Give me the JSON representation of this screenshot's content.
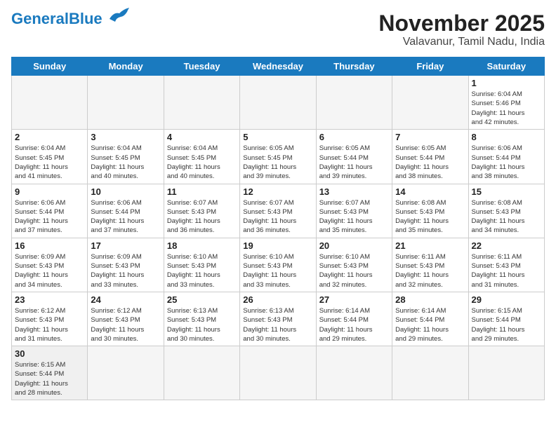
{
  "header": {
    "logo_general": "General",
    "logo_blue": "Blue",
    "month_title": "November 2025",
    "location": "Valavanur, Tamil Nadu, India"
  },
  "weekdays": [
    "Sunday",
    "Monday",
    "Tuesday",
    "Wednesday",
    "Thursday",
    "Friday",
    "Saturday"
  ],
  "rows": [
    [
      {
        "day": "",
        "info": ""
      },
      {
        "day": "",
        "info": ""
      },
      {
        "day": "",
        "info": ""
      },
      {
        "day": "",
        "info": ""
      },
      {
        "day": "",
        "info": ""
      },
      {
        "day": "",
        "info": ""
      },
      {
        "day": "1",
        "info": "Sunrise: 6:04 AM\nSunset: 5:46 PM\nDaylight: 11 hours\nand 42 minutes."
      }
    ],
    [
      {
        "day": "2",
        "info": "Sunrise: 6:04 AM\nSunset: 5:45 PM\nDaylight: 11 hours\nand 41 minutes."
      },
      {
        "day": "3",
        "info": "Sunrise: 6:04 AM\nSunset: 5:45 PM\nDaylight: 11 hours\nand 40 minutes."
      },
      {
        "day": "4",
        "info": "Sunrise: 6:04 AM\nSunset: 5:45 PM\nDaylight: 11 hours\nand 40 minutes."
      },
      {
        "day": "5",
        "info": "Sunrise: 6:05 AM\nSunset: 5:45 PM\nDaylight: 11 hours\nand 39 minutes."
      },
      {
        "day": "6",
        "info": "Sunrise: 6:05 AM\nSunset: 5:44 PM\nDaylight: 11 hours\nand 39 minutes."
      },
      {
        "day": "7",
        "info": "Sunrise: 6:05 AM\nSunset: 5:44 PM\nDaylight: 11 hours\nand 38 minutes."
      },
      {
        "day": "8",
        "info": "Sunrise: 6:06 AM\nSunset: 5:44 PM\nDaylight: 11 hours\nand 38 minutes."
      }
    ],
    [
      {
        "day": "9",
        "info": "Sunrise: 6:06 AM\nSunset: 5:44 PM\nDaylight: 11 hours\nand 37 minutes."
      },
      {
        "day": "10",
        "info": "Sunrise: 6:06 AM\nSunset: 5:44 PM\nDaylight: 11 hours\nand 37 minutes."
      },
      {
        "day": "11",
        "info": "Sunrise: 6:07 AM\nSunset: 5:43 PM\nDaylight: 11 hours\nand 36 minutes."
      },
      {
        "day": "12",
        "info": "Sunrise: 6:07 AM\nSunset: 5:43 PM\nDaylight: 11 hours\nand 36 minutes."
      },
      {
        "day": "13",
        "info": "Sunrise: 6:07 AM\nSunset: 5:43 PM\nDaylight: 11 hours\nand 35 minutes."
      },
      {
        "day": "14",
        "info": "Sunrise: 6:08 AM\nSunset: 5:43 PM\nDaylight: 11 hours\nand 35 minutes."
      },
      {
        "day": "15",
        "info": "Sunrise: 6:08 AM\nSunset: 5:43 PM\nDaylight: 11 hours\nand 34 minutes."
      }
    ],
    [
      {
        "day": "16",
        "info": "Sunrise: 6:09 AM\nSunset: 5:43 PM\nDaylight: 11 hours\nand 34 minutes."
      },
      {
        "day": "17",
        "info": "Sunrise: 6:09 AM\nSunset: 5:43 PM\nDaylight: 11 hours\nand 33 minutes."
      },
      {
        "day": "18",
        "info": "Sunrise: 6:10 AM\nSunset: 5:43 PM\nDaylight: 11 hours\nand 33 minutes."
      },
      {
        "day": "19",
        "info": "Sunrise: 6:10 AM\nSunset: 5:43 PM\nDaylight: 11 hours\nand 33 minutes."
      },
      {
        "day": "20",
        "info": "Sunrise: 6:10 AM\nSunset: 5:43 PM\nDaylight: 11 hours\nand 32 minutes."
      },
      {
        "day": "21",
        "info": "Sunrise: 6:11 AM\nSunset: 5:43 PM\nDaylight: 11 hours\nand 32 minutes."
      },
      {
        "day": "22",
        "info": "Sunrise: 6:11 AM\nSunset: 5:43 PM\nDaylight: 11 hours\nand 31 minutes."
      }
    ],
    [
      {
        "day": "23",
        "info": "Sunrise: 6:12 AM\nSunset: 5:43 PM\nDaylight: 11 hours\nand 31 minutes."
      },
      {
        "day": "24",
        "info": "Sunrise: 6:12 AM\nSunset: 5:43 PM\nDaylight: 11 hours\nand 30 minutes."
      },
      {
        "day": "25",
        "info": "Sunrise: 6:13 AM\nSunset: 5:43 PM\nDaylight: 11 hours\nand 30 minutes."
      },
      {
        "day": "26",
        "info": "Sunrise: 6:13 AM\nSunset: 5:43 PM\nDaylight: 11 hours\nand 30 minutes."
      },
      {
        "day": "27",
        "info": "Sunrise: 6:14 AM\nSunset: 5:44 PM\nDaylight: 11 hours\nand 29 minutes."
      },
      {
        "day": "28",
        "info": "Sunrise: 6:14 AM\nSunset: 5:44 PM\nDaylight: 11 hours\nand 29 minutes."
      },
      {
        "day": "29",
        "info": "Sunrise: 6:15 AM\nSunset: 5:44 PM\nDaylight: 11 hours\nand 29 minutes."
      }
    ],
    [
      {
        "day": "30",
        "info": "Sunrise: 6:15 AM\nSunset: 5:44 PM\nDaylight: 11 hours\nand 28 minutes."
      },
      {
        "day": "",
        "info": ""
      },
      {
        "day": "",
        "info": ""
      },
      {
        "day": "",
        "info": ""
      },
      {
        "day": "",
        "info": ""
      },
      {
        "day": "",
        "info": ""
      },
      {
        "day": "",
        "info": ""
      }
    ]
  ]
}
